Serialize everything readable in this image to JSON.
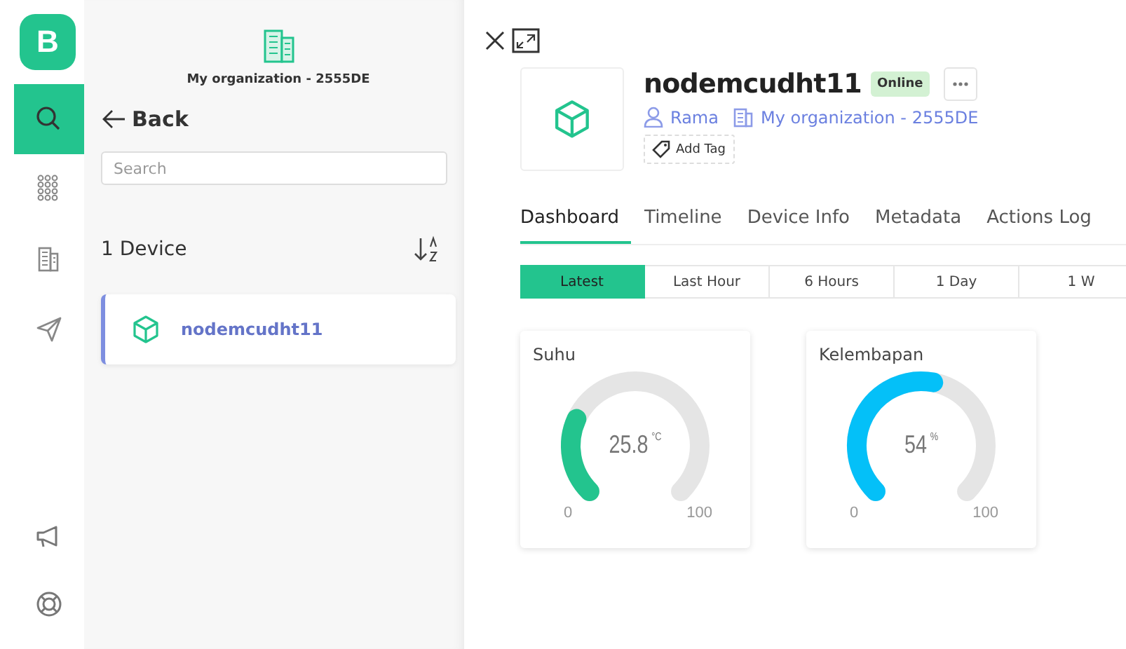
{
  "logo": {
    "letter": "B"
  },
  "nav": [
    {
      "selected": true
    },
    {
      "selected": false
    },
    {
      "selected": false
    },
    {
      "selected": false
    }
  ],
  "panel": {
    "organization": "My organization - 2555DE",
    "back": "Back",
    "search": {
      "placeholder": "Search"
    },
    "count": "1 Device",
    "devices": [
      {
        "name": "nodemcudht11",
        "selected": true
      }
    ]
  },
  "device": {
    "name": "nodemcudht11",
    "status": "Online",
    "owner": "Rama",
    "organization": "My organization - 2555DE",
    "add_tag": "Add Tag"
  },
  "tabs": [
    {
      "label": "Dashboard",
      "selected": true
    },
    {
      "label": "Timeline",
      "selected": false
    },
    {
      "label": "Device Info",
      "selected": false
    },
    {
      "label": "Metadata",
      "selected": false
    },
    {
      "label": "Actions Log",
      "selected": false
    }
  ],
  "ranges": [
    {
      "label": "Latest",
      "selected": true
    },
    {
      "label": "Last Hour",
      "selected": false
    },
    {
      "label": "6 Hours",
      "selected": false
    },
    {
      "label": "1 Day",
      "selected": false
    },
    {
      "label": "1 W",
      "selected": false
    }
  ],
  "widgets": [
    {
      "title": "Suhu",
      "value": "25.8",
      "unit": "°C",
      "min": "0",
      "max": "100",
      "color": "#23c48e"
    },
    {
      "title": "Kelembapan",
      "value": "54",
      "unit": "%",
      "min": "0",
      "max": "100",
      "color": "#04c0f8"
    }
  ]
}
